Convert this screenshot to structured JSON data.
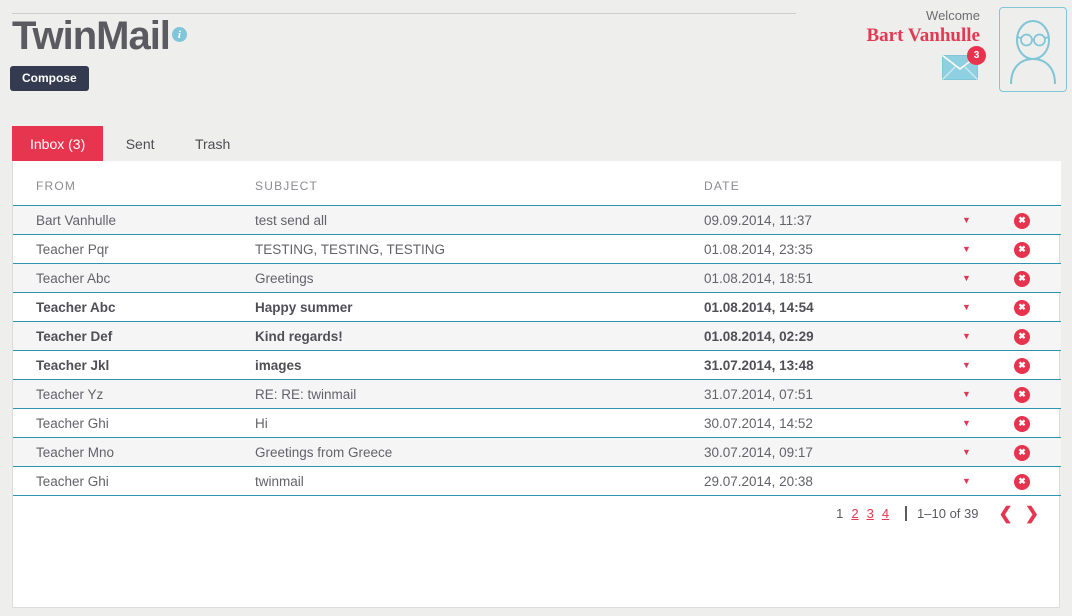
{
  "app": {
    "title": "TwinMail",
    "info_icon": "info-icon"
  },
  "toolbar": {
    "compose_label": "Compose"
  },
  "user": {
    "welcome_label": "Welcome",
    "name": "Bart Vanhulle",
    "mail_icon": "envelope-icon",
    "unread_badge": "3",
    "avatar_icon": "user-avatar-icon"
  },
  "tabs": [
    {
      "label": "Inbox (3)",
      "active": true
    },
    {
      "label": "Sent",
      "active": false
    },
    {
      "label": "Trash",
      "active": false
    }
  ],
  "table": {
    "headers": {
      "from": "FROM",
      "subject": "SUBJECT",
      "date": "DATE"
    },
    "rows": [
      {
        "from": "Bart Vanhulle",
        "subject": "test send all",
        "date": "09.09.2014, 11:37",
        "unread": false
      },
      {
        "from": "Teacher Pqr",
        "subject": "TESTING, TESTING, TESTING",
        "date": "01.08.2014, 23:35",
        "unread": false
      },
      {
        "from": "Teacher Abc",
        "subject": "Greetings",
        "date": "01.08.2014, 18:51",
        "unread": false
      },
      {
        "from": "Teacher Abc",
        "subject": "Happy summer",
        "date": "01.08.2014, 14:54",
        "unread": true
      },
      {
        "from": "Teacher Def",
        "subject": "Kind regards!",
        "date": "01.08.2014, 02:29",
        "unread": true
      },
      {
        "from": "Teacher Jkl",
        "subject": "images",
        "date": "31.07.2014, 13:48",
        "unread": true
      },
      {
        "from": "Teacher Yz",
        "subject": "RE: RE: twinmail",
        "date": "31.07.2014, 07:51",
        "unread": false
      },
      {
        "from": "Teacher Ghi",
        "subject": "Hi",
        "date": "30.07.2014, 14:52",
        "unread": false
      },
      {
        "from": "Teacher Mno",
        "subject": "Greetings from Greece",
        "date": "30.07.2014, 09:17",
        "unread": false
      },
      {
        "from": "Teacher Ghi",
        "subject": "twinmail",
        "date": "29.07.2014, 20:38",
        "unread": false
      }
    ],
    "row_caret": "▼",
    "row_delete": "✖"
  },
  "pagination": {
    "pages": [
      "1",
      "2",
      "3",
      "4"
    ],
    "current_page": "1",
    "range_label": "1–10 of 39",
    "prev_arrow": "❮",
    "next_arrow": "❯"
  },
  "colors": {
    "accent_red": "#e8354f",
    "accent_teal": "#2f93ad",
    "light_blue": "#7fc6d9",
    "dark_navy": "#343a4f",
    "page_bg": "#eeeeec"
  }
}
